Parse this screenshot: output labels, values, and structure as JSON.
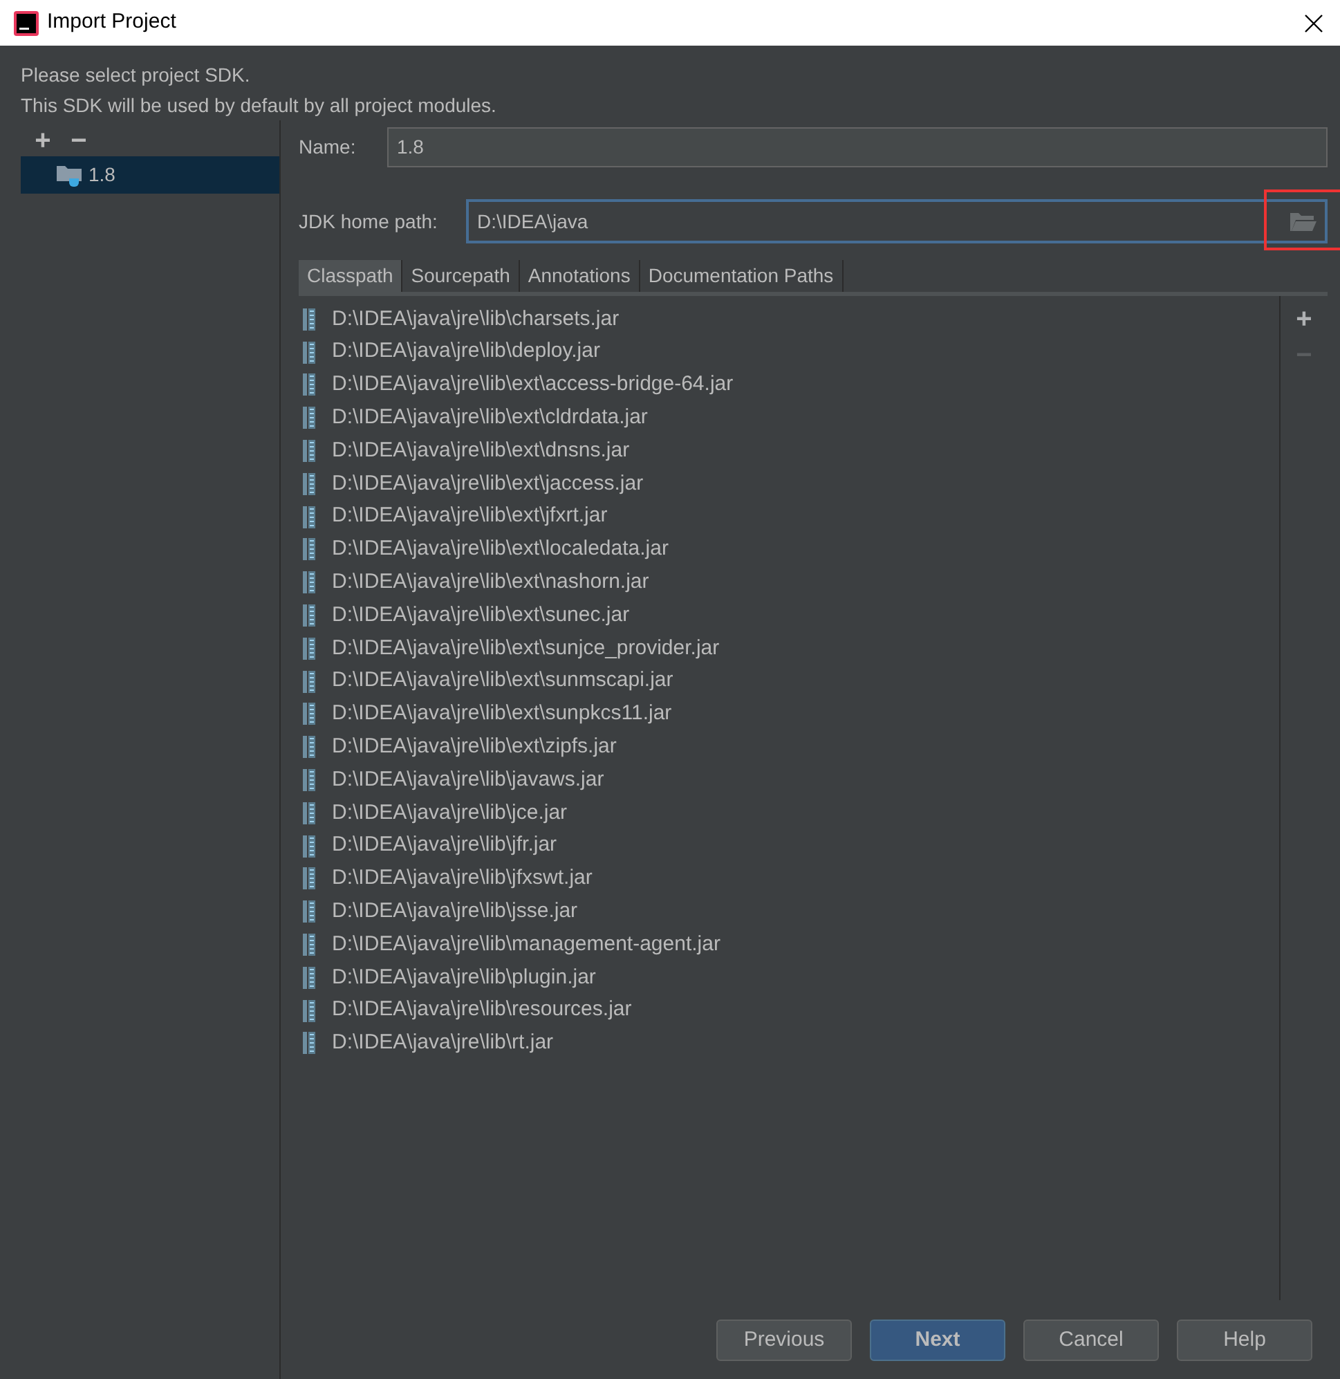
{
  "window": {
    "title": "Import Project"
  },
  "intro": [
    "Please select project SDK.",
    "This SDK will be used by default by all project modules."
  ],
  "sdk_toolbar": [
    "+",
    "−"
  ],
  "sdk_list": [
    {
      "label": "1.8",
      "selected": true
    }
  ],
  "name_field": {
    "label": "Name:",
    "value": "1.8"
  },
  "jdk_field": {
    "label": "JDK home path:",
    "value": "D:\\IDEA\\java",
    "focused": true,
    "browse_highlighted": true
  },
  "tabs": [
    {
      "label": "Classpath",
      "selected": true
    },
    {
      "label": "Sourcepath",
      "selected": false
    },
    {
      "label": "Annotations",
      "selected": false
    },
    {
      "label": "Documentation Paths",
      "selected": false
    }
  ],
  "classpath": [
    "D:\\IDEA\\java\\jre\\lib\\charsets.jar",
    "D:\\IDEA\\java\\jre\\lib\\deploy.jar",
    "D:\\IDEA\\java\\jre\\lib\\ext\\access-bridge-64.jar",
    "D:\\IDEA\\java\\jre\\lib\\ext\\cldrdata.jar",
    "D:\\IDEA\\java\\jre\\lib\\ext\\dnsns.jar",
    "D:\\IDEA\\java\\jre\\lib\\ext\\jaccess.jar",
    "D:\\IDEA\\java\\jre\\lib\\ext\\jfxrt.jar",
    "D:\\IDEA\\java\\jre\\lib\\ext\\localedata.jar",
    "D:\\IDEA\\java\\jre\\lib\\ext\\nashorn.jar",
    "D:\\IDEA\\java\\jre\\lib\\ext\\sunec.jar",
    "D:\\IDEA\\java\\jre\\lib\\ext\\sunjce_provider.jar",
    "D:\\IDEA\\java\\jre\\lib\\ext\\sunmscapi.jar",
    "D:\\IDEA\\java\\jre\\lib\\ext\\sunpkcs11.jar",
    "D:\\IDEA\\java\\jre\\lib\\ext\\zipfs.jar",
    "D:\\IDEA\\java\\jre\\lib\\javaws.jar",
    "D:\\IDEA\\java\\jre\\lib\\jce.jar",
    "D:\\IDEA\\java\\jre\\lib\\jfr.jar",
    "D:\\IDEA\\java\\jre\\lib\\jfxswt.jar",
    "D:\\IDEA\\java\\jre\\lib\\jsse.jar",
    "D:\\IDEA\\java\\jre\\lib\\management-agent.jar",
    "D:\\IDEA\\java\\jre\\lib\\plugin.jar",
    "D:\\IDEA\\java\\jre\\lib\\resources.jar",
    "D:\\IDEA\\java\\jre\\lib\\rt.jar"
  ],
  "list_toolbar": [
    {
      "label": "+",
      "disabled": false
    },
    {
      "label": "−",
      "disabled": true
    }
  ],
  "buttons": [
    {
      "label": "Previous",
      "primary": false
    },
    {
      "label": "Next",
      "primary": true
    },
    {
      "label": "Cancel",
      "primary": false
    },
    {
      "label": "Help",
      "primary": false
    }
  ]
}
